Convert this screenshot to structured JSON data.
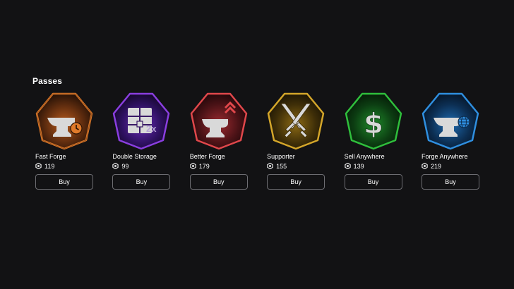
{
  "section": {
    "title": "Passes"
  },
  "passes": [
    {
      "name": "Fast Forge",
      "price": "119",
      "buy_label": "Buy",
      "color": "#e07a2a",
      "icon": "anvil-clock-icon"
    },
    {
      "name": "Double Storage",
      "price": "99",
      "buy_label": "Buy",
      "color": "#8a3ee0",
      "icon": "storage-2x-icon"
    },
    {
      "name": "Better Forge",
      "price": "179",
      "buy_label": "Buy",
      "color": "#e0474b",
      "icon": "anvil-upgrade-icon"
    },
    {
      "name": "Supporter",
      "price": "155",
      "buy_label": "Buy",
      "color": "#d4a62a",
      "icon": "crossed-swords-icon"
    },
    {
      "name": "Sell Anywhere",
      "price": "139",
      "buy_label": "Buy",
      "color": "#2fbf3c",
      "icon": "dollar-icon"
    },
    {
      "name": "Forge Anywhere",
      "price": "219",
      "buy_label": "Buy",
      "color": "#2f8fe0",
      "icon": "anvil-globe-icon"
    }
  ]
}
